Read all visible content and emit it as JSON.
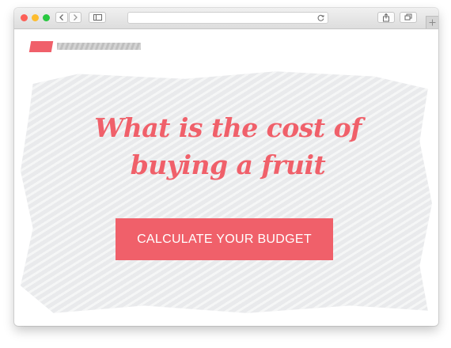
{
  "browser": {
    "traffic_lights": {
      "close": "#fc5f57",
      "minimize": "#fdbc2e",
      "maximize": "#28c840"
    },
    "icons": [
      "chevron-left-icon",
      "chevron-right-icon",
      "sidebar-icon",
      "reload-icon",
      "share-icon",
      "tabs-icon",
      "plus-icon"
    ]
  },
  "page": {
    "brand_color": "#f0606a",
    "headline": {
      "line1": "What is the cost of",
      "line2": "buying a fruit"
    },
    "cta_label": "CALCULATE YOUR BUDGET"
  }
}
